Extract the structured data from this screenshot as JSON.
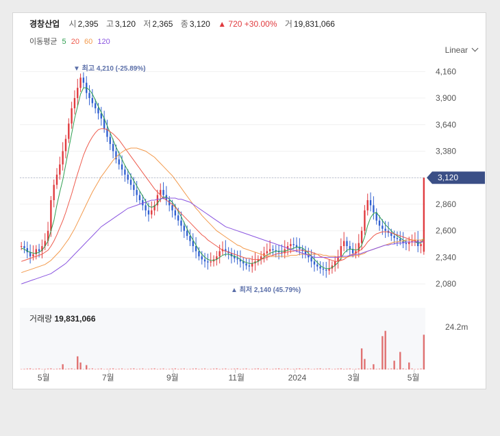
{
  "header": {
    "name": "경창산업",
    "open_label": "시",
    "open": "2,395",
    "high_label": "고",
    "high": "3,120",
    "low_label": "저",
    "low": "2,365",
    "close_label": "종",
    "close": "3,120",
    "change": "▲ 720",
    "change_pct": "+30.00%",
    "volume_label": "거",
    "volume": "19,831,066"
  },
  "ma_legend": {
    "label": "이동평균",
    "items": [
      {
        "period": "5",
        "color": "#2e9e4f"
      },
      {
        "period": "20",
        "color": "#ee5a4c"
      },
      {
        "period": "60",
        "color": "#f39a4c"
      },
      {
        "period": "120",
        "color": "#8a55e0"
      }
    ]
  },
  "scale_selector": {
    "value": "Linear"
  },
  "volume_panel": {
    "label": "거래량",
    "value": "19,831,066",
    "axis_label": "24.2m"
  },
  "chart_data": {
    "type": "candlestick",
    "y_ticks": [
      "4,160",
      "3,900",
      "3,640",
      "3,380",
      "3,120",
      "2,860",
      "2,600",
      "2,340",
      "2,080"
    ],
    "ylim": [
      1980,
      4330
    ],
    "x_ticks": [
      "5월",
      "7월",
      "9월",
      "11월",
      "2024",
      "3월",
      "5월"
    ],
    "current_price": "3,120",
    "max_annotation": {
      "arrow": "▼",
      "label": "최고",
      "value": "4,210",
      "pct": "(-25.89%)"
    },
    "min_annotation": {
      "arrow": "▲",
      "label": "최저",
      "value": "2,140",
      "pct": "(45.79%)"
    },
    "up_color": "#e03a3e",
    "down_color": "#2f5fd0",
    "close_series": [
      2450,
      2430,
      2390,
      2350,
      2370,
      2420,
      2400,
      2450,
      2500,
      2600,
      2900,
      3050,
      3150,
      3250,
      3380,
      3500,
      3650,
      3800,
      3900,
      4000,
      4100,
      4050,
      3950,
      3900,
      3850,
      3800,
      3750,
      3700,
      3600,
      3520,
      3450,
      3380,
      3300,
      3250,
      3200,
      3150,
      3100,
      3050,
      3000,
      2950,
      2900,
      2850,
      2800,
      2760,
      2800,
      2850,
      2950,
      3000,
      2950,
      2900,
      2850,
      2800,
      2750,
      2700,
      2650,
      2600,
      2550,
      2500,
      2450,
      2400,
      2350,
      2320,
      2300,
      2290,
      2300,
      2320,
      2350,
      2400,
      2420,
      2400,
      2380,
      2350,
      2330,
      2320,
      2300,
      2280,
      2260,
      2250,
      2280,
      2300,
      2320,
      2350,
      2380,
      2400,
      2420,
      2410,
      2400,
      2390,
      2380,
      2420,
      2450,
      2470,
      2460,
      2440,
      2420,
      2400,
      2370,
      2340,
      2300,
      2270,
      2250,
      2230,
      2220,
      2210,
      2230,
      2260,
      2300,
      2350,
      2450,
      2500,
      2450,
      2420,
      2380,
      2400,
      2480,
      2600,
      2800,
      2900,
      2850,
      2780,
      2700,
      2650,
      2620,
      2600,
      2580,
      2550,
      2530,
      2520,
      2500,
      2480,
      2470,
      2490,
      2500,
      2510,
      2450,
      2470,
      3120
    ],
    "ma5": [
      2430,
      2420,
      2400,
      2390,
      2380,
      2380,
      2390,
      2410,
      2450,
      2500,
      2600,
      2700,
      2850,
      2980,
      3100,
      3250,
      3400,
      3550,
      3700,
      3820,
      3940,
      4000,
      4000,
      3980,
      3940,
      3880,
      3820,
      3760,
      3700,
      3630,
      3560,
      3490,
      3420,
      3360,
      3300,
      3240,
      3190,
      3140,
      3090,
      3040,
      2990,
      2940,
      2890,
      2840,
      2830,
      2840,
      2870,
      2910,
      2930,
      2930,
      2910,
      2880,
      2840,
      2790,
      2740,
      2680,
      2620,
      2560,
      2510,
      2460,
      2410,
      2370,
      2340,
      2320,
      2310,
      2310,
      2320,
      2340,
      2360,
      2370,
      2370,
      2360,
      2350,
      2340,
      2320,
      2300,
      2290,
      2280,
      2280,
      2290,
      2300,
      2320,
      2340,
      2360,
      2380,
      2390,
      2400,
      2400,
      2400,
      2400,
      2410,
      2420,
      2430,
      2440,
      2440,
      2430,
      2410,
      2380,
      2350,
      2320,
      2290,
      2260,
      2240,
      2230,
      2230,
      2240,
      2260,
      2290,
      2330,
      2380,
      2410,
      2420,
      2420,
      2410,
      2420,
      2460,
      2540,
      2650,
      2730,
      2770,
      2780,
      2740,
      2700,
      2660,
      2630,
      2600,
      2570,
      2550,
      2530,
      2510,
      2490,
      2490,
      2490,
      2490,
      2480,
      2480,
      2530
    ],
    "ma20": [
      2300,
      2310,
      2320,
      2330,
      2340,
      2350,
      2360,
      2370,
      2390,
      2410,
      2450,
      2500,
      2560,
      2630,
      2700,
      2780,
      2870,
      2960,
      3060,
      3160,
      3250,
      3340,
      3410,
      3470,
      3520,
      3560,
      3590,
      3600,
      3600,
      3590,
      3570,
      3550,
      3520,
      3490,
      3450,
      3410,
      3370,
      3330,
      3290,
      3250,
      3210,
      3170,
      3130,
      3090,
      3050,
      3010,
      2980,
      2950,
      2920,
      2900,
      2880,
      2860,
      2830,
      2800,
      2770,
      2740,
      2710,
      2680,
      2650,
      2620,
      2590,
      2560,
      2540,
      2510,
      2490,
      2470,
      2450,
      2430,
      2410,
      2400,
      2390,
      2380,
      2370,
      2360,
      2350,
      2340,
      2330,
      2330,
      2320,
      2320,
      2320,
      2320,
      2330,
      2340,
      2350,
      2360,
      2370,
      2380,
      2380,
      2390,
      2390,
      2400,
      2400,
      2410,
      2410,
      2410,
      2400,
      2400,
      2390,
      2380,
      2370,
      2350,
      2340,
      2330,
      2320,
      2310,
      2300,
      2300,
      2310,
      2320,
      2340,
      2360,
      2370,
      2380,
      2400,
      2420,
      2450,
      2490,
      2520,
      2550,
      2570,
      2580,
      2590,
      2590,
      2590,
      2580,
      2570,
      2560,
      2550,
      2540,
      2530,
      2520,
      2510,
      2500,
      2490,
      2490,
      2500
    ],
    "ma60": [
      2190,
      2200,
      2210,
      2220,
      2230,
      2240,
      2250,
      2260,
      2270,
      2290,
      2310,
      2340,
      2370,
      2400,
      2440,
      2480,
      2520,
      2570,
      2620,
      2680,
      2740,
      2800,
      2860,
      2920,
      2980,
      3030,
      3080,
      3130,
      3170,
      3210,
      3250,
      3290,
      3320,
      3350,
      3370,
      3390,
      3400,
      3410,
      3410,
      3410,
      3400,
      3390,
      3380,
      3360,
      3340,
      3320,
      3290,
      3260,
      3230,
      3200,
      3170,
      3140,
      3100,
      3060,
      3020,
      2980,
      2940,
      2900,
      2860,
      2820,
      2790,
      2750,
      2720,
      2690,
      2660,
      2630,
      2600,
      2580,
      2560,
      2540,
      2520,
      2500,
      2480,
      2460,
      2450,
      2430,
      2420,
      2410,
      2400,
      2390,
      2380,
      2370,
      2360,
      2360,
      2350,
      2350,
      2350,
      2350,
      2350,
      2350,
      2350,
      2360,
      2360,
      2360,
      2370,
      2370,
      2370,
      2370,
      2370,
      2370,
      2370,
      2370,
      2360,
      2360,
      2350,
      2350,
      2350,
      2340,
      2340,
      2340,
      2340,
      2350,
      2350,
      2360,
      2360,
      2370,
      2380,
      2400,
      2410,
      2420,
      2430,
      2440,
      2450,
      2460,
      2470,
      2480,
      2490,
      2490,
      2500,
      2500,
      2510,
      2510,
      2510,
      2510,
      2510,
      2510,
      2520
    ],
    "ma120": [
      2080,
      2090,
      2100,
      2110,
      2120,
      2130,
      2140,
      2150,
      2160,
      2170,
      2180,
      2200,
      2220,
      2240,
      2260,
      2280,
      2310,
      2340,
      2370,
      2400,
      2430,
      2460,
      2490,
      2520,
      2550,
      2580,
      2610,
      2640,
      2660,
      2680,
      2700,
      2720,
      2740,
      2760,
      2780,
      2800,
      2820,
      2830,
      2840,
      2850,
      2860,
      2870,
      2880,
      2890,
      2900,
      2900,
      2910,
      2910,
      2920,
      2920,
      2920,
      2920,
      2920,
      2910,
      2910,
      2900,
      2890,
      2880,
      2860,
      2840,
      2820,
      2800,
      2780,
      2760,
      2740,
      2720,
      2700,
      2680,
      2660,
      2640,
      2630,
      2620,
      2610,
      2600,
      2590,
      2580,
      2570,
      2560,
      2550,
      2540,
      2530,
      2520,
      2510,
      2500,
      2490,
      2480,
      2470,
      2460,
      2450,
      2440,
      2430,
      2420,
      2410,
      2400,
      2390,
      2380,
      2370,
      2360,
      2350,
      2340,
      2340,
      2340,
      2340,
      2340,
      2340,
      2340,
      2340,
      2340,
      2350,
      2350,
      2350,
      2360,
      2360,
      2370,
      2370,
      2380,
      2390,
      2400,
      2410,
      2420,
      2430,
      2440,
      2450,
      2460,
      2460,
      2470,
      2470,
      2480,
      2480,
      2480,
      2490,
      2490,
      2490,
      2490,
      2490,
      2490,
      2490
    ],
    "volume_ymax": 24.2,
    "volume_spikes": [
      {
        "i": 14,
        "v": 3.0
      },
      {
        "i": 19,
        "v": 7.5
      },
      {
        "i": 20,
        "v": 4.0
      },
      {
        "i": 22,
        "v": 2.5
      },
      {
        "i": 115,
        "v": 12.0
      },
      {
        "i": 116,
        "v": 6.0
      },
      {
        "i": 119,
        "v": 3.0
      },
      {
        "i": 122,
        "v": 19.0
      },
      {
        "i": 123,
        "v": 22.0
      },
      {
        "i": 126,
        "v": 5.0
      },
      {
        "i": 128,
        "v": 10.0
      },
      {
        "i": 131,
        "v": 4.0
      },
      {
        "i": 136,
        "v": 19.8
      }
    ]
  }
}
